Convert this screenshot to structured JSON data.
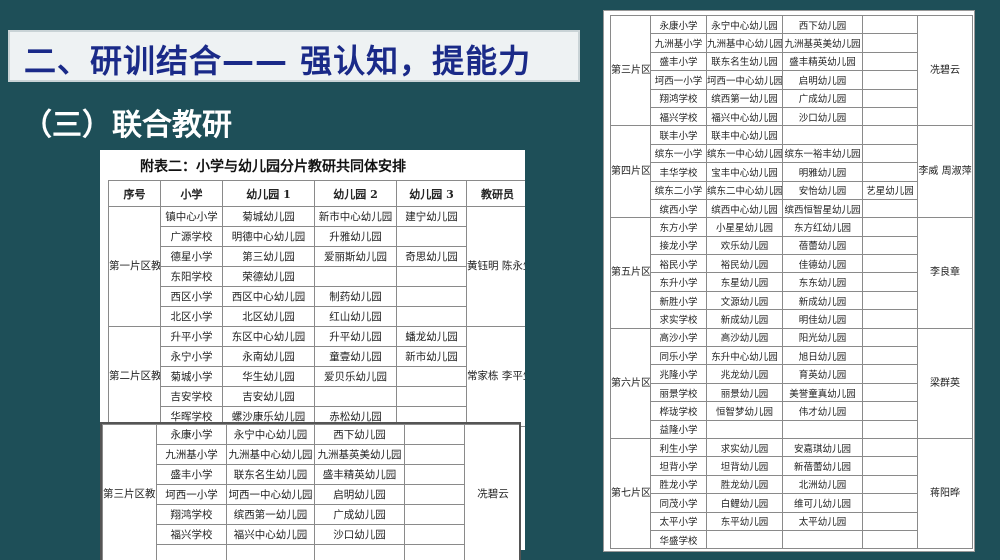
{
  "header": {
    "title": "二、研训结合—— 强认知，提能力",
    "subtitle": "（三）联合教研"
  },
  "document": {
    "appendix_title": "附表二：小学与幼儿园分片教研共同体安排",
    "columns": [
      "序号",
      "小学",
      "幼儿园 1",
      "幼儿园 2",
      "幼儿园 3",
      "教研员"
    ]
  },
  "left_table": {
    "groups": [
      {
        "name": "第一片区教研共同体",
        "researcher": "黄钰明 陈永生",
        "rows": [
          [
            "镇中心小学",
            "菊城幼儿园",
            "新市中心幼儿园",
            "建宁幼儿园"
          ],
          [
            "广源学校",
            "明德中心幼儿园",
            "升雅幼儿园",
            ""
          ],
          [
            "德星小学",
            "第三幼儿园",
            "爱丽斯幼儿园",
            "奇思幼儿园"
          ],
          [
            "东阳学校",
            "荣德幼儿园",
            "",
            ""
          ],
          [
            "西区小学",
            "西区中心幼儿园",
            "制药幼儿园",
            ""
          ],
          [
            "北区小学",
            "北区幼儿园",
            "红山幼儿园",
            ""
          ]
        ]
      },
      {
        "name": "第二片区教研共同体",
        "researcher": "常家栋 李平生",
        "rows": [
          [
            "升平小学",
            "东区中心幼儿园",
            "升平幼儿园",
            "蟠龙幼儿园"
          ],
          [
            "永宁小学",
            "永南幼儿园",
            "童壹幼儿园",
            "新市幼儿园"
          ],
          [
            "菊城小学",
            "华生幼儿园",
            "爱贝乐幼儿园",
            ""
          ],
          [
            "吉安学校",
            "吉安幼儿园",
            "",
            ""
          ],
          [
            "华晖学校",
            "螺沙康乐幼儿园",
            "赤松幼儿园",
            ""
          ]
        ]
      }
    ]
  },
  "overlay_table": {
    "group": {
      "name": "第三片区教研共同体",
      "researcher": "冼碧云",
      "rows": [
        [
          "永康小学",
          "永宁中心幼儿园",
          "西下幼儿园",
          ""
        ],
        [
          "九洲基小学",
          "九洲基中心幼儿园",
          "九洲基英美幼儿园",
          ""
        ],
        [
          "盛丰小学",
          "联东名生幼儿园",
          "盛丰精英幼儿园",
          ""
        ],
        [
          "坷西一小学",
          "坷西一中心幼儿园",
          "启明幼儿园",
          ""
        ],
        [
          "翔鸿学校",
          "缤西第一幼儿园",
          "广成幼儿园",
          ""
        ],
        [
          "福兴学校",
          "福兴中心幼儿园",
          "沙口幼儿园",
          ""
        ],
        [
          "",
          "",
          "",
          ""
        ]
      ]
    }
  },
  "right_table": {
    "groups": [
      {
        "name": "第三片区教研共同体",
        "researcher": "冼碧云",
        "rows": [
          [
            "永康小学",
            "永宁中心幼儿园",
            "西下幼儿园",
            ""
          ],
          [
            "九洲基小学",
            "九洲基中心幼儿园",
            "九洲基英美幼儿园",
            ""
          ],
          [
            "盛丰小学",
            "联东名生幼儿园",
            "盛丰精英幼儿园",
            ""
          ],
          [
            "坷西一小学",
            "坷西一中心幼儿园",
            "启明幼儿园",
            ""
          ],
          [
            "翔鸿学校",
            "缤西第一幼儿园",
            "广成幼儿园",
            ""
          ],
          [
            "福兴学校",
            "福兴中心幼儿园",
            "沙口幼儿园",
            ""
          ]
        ]
      },
      {
        "name": "第四片区教研共同体",
        "researcher": "李威 周淑萍",
        "rows": [
          [
            "联丰小学",
            "联丰中心幼儿园",
            "",
            ""
          ],
          [
            "缤东一小学",
            "缤东一中心幼儿园",
            "缤东一裕丰幼儿园",
            ""
          ],
          [
            "丰华学校",
            "宝丰中心幼儿园",
            "明雅幼儿园",
            ""
          ],
          [
            "缤东二小学",
            "缤东二中心幼儿园",
            "安怡幼儿园",
            "艺星幼儿园"
          ],
          [
            "缤西小学",
            "缤西中心幼儿园",
            "缤西恒智星幼儿园",
            ""
          ]
        ]
      },
      {
        "name": "第五片区教研共同体",
        "researcher": "李良章",
        "rows": [
          [
            "东方小学",
            "小星星幼儿园",
            "东方红幼儿园",
            ""
          ],
          [
            "接龙小学",
            "欢乐幼儿园",
            "蓓蕾幼儿园",
            ""
          ],
          [
            "裕民小学",
            "裕民幼儿园",
            "佳德幼儿园",
            ""
          ],
          [
            "东升小学",
            "东星幼儿园",
            "东东幼儿园",
            ""
          ],
          [
            "新胜小学",
            "文源幼儿园",
            "新成幼儿园",
            ""
          ],
          [
            "求实学校",
            "新成幼儿园",
            "明佳幼儿园",
            ""
          ]
        ]
      },
      {
        "name": "第六片区教研共同体",
        "researcher": "梁群英",
        "rows": [
          [
            "高沙小学",
            "高沙幼儿园",
            "阳光幼儿园",
            ""
          ],
          [
            "同乐小学",
            "东升中心幼儿园",
            "旭日幼儿园",
            ""
          ],
          [
            "兆隆小学",
            "兆龙幼儿园",
            "育英幼儿园",
            ""
          ],
          [
            "丽景学校",
            "丽景幼儿园",
            "美誉童真幼儿园",
            ""
          ],
          [
            "桦珑学校",
            "恒智梦幼儿园",
            "伟才幼儿园",
            ""
          ],
          [
            "益隆小学",
            "",
            "",
            ""
          ]
        ]
      },
      {
        "name": "第七片区教研共同体",
        "researcher": "蒋阳晔",
        "rows": [
          [
            "利生小学",
            "求实幼儿园",
            "安嘉琪幼儿园",
            ""
          ],
          [
            "坦背小学",
            "坦背幼儿园",
            "新蓓蕾幼儿园",
            ""
          ],
          [
            "胜龙小学",
            "胜龙幼儿园",
            "北洲幼儿园",
            ""
          ],
          [
            "同茂小学",
            "白鲤幼儿园",
            "维可儿幼儿园",
            ""
          ],
          [
            "太平小学",
            "东平幼儿园",
            "太平幼儿园",
            ""
          ],
          [
            "华盛学校",
            "",
            "",
            ""
          ]
        ]
      }
    ]
  }
}
